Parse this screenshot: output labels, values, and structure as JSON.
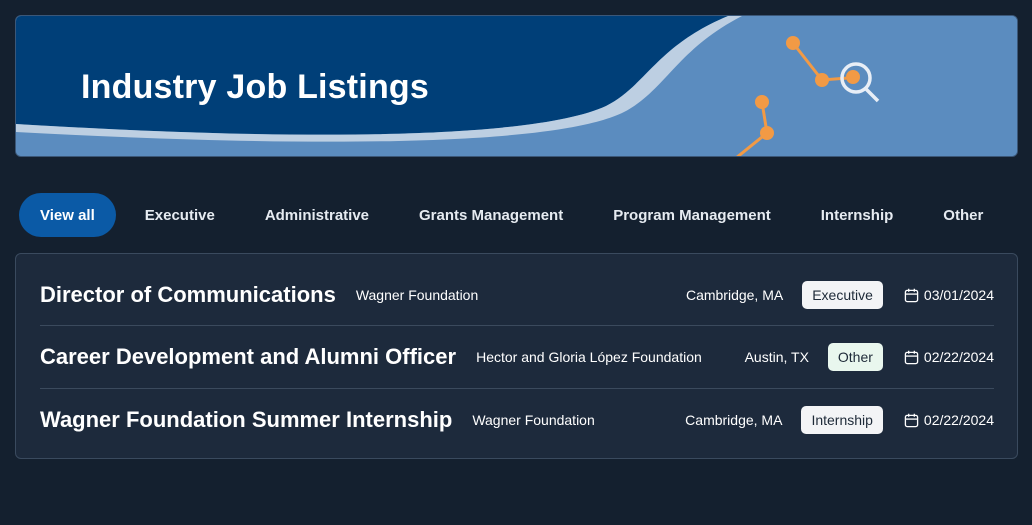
{
  "banner": {
    "title": "Industry Job Listings",
    "icon": "magnifier-icon",
    "colors": {
      "dark": "#003f78",
      "light": "#5b8cbf",
      "accent": "#f29a45"
    }
  },
  "tabs": [
    {
      "label": "View all",
      "active": true
    },
    {
      "label": "Executive"
    },
    {
      "label": "Administrative"
    },
    {
      "label": "Grants Management"
    },
    {
      "label": "Program Management"
    },
    {
      "label": "Internship"
    },
    {
      "label": "Other"
    }
  ],
  "listings": [
    {
      "title": "Director of Communications",
      "org": "Wagner Foundation",
      "location": "Cambridge, MA",
      "category": "Executive",
      "date": "03/01/2024"
    },
    {
      "title": "Career Development and Alumni Officer",
      "org": "Hector and Gloria López Foundation",
      "location": "Austin, TX",
      "category": "Other",
      "date": "02/22/2024"
    },
    {
      "title": "Wagner Foundation Summer Internship",
      "org": "Wagner Foundation",
      "location": "Cambridge, MA",
      "category": "Internship",
      "date": "02/22/2024"
    }
  ]
}
